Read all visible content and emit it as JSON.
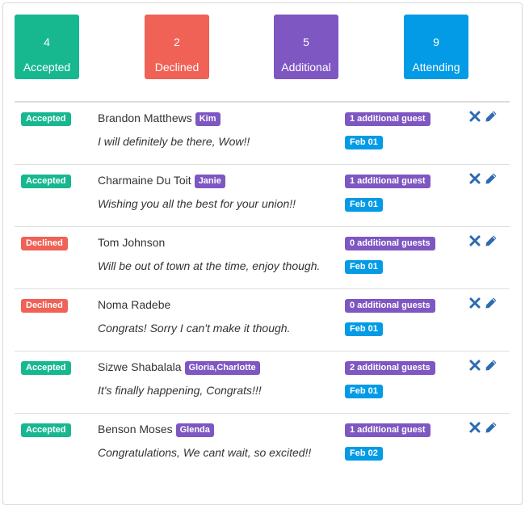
{
  "colors": {
    "accepted": "#17b890",
    "declined": "#f06156",
    "additional": "#7e57c2",
    "attending": "#039be5",
    "icon": "#2d6ab0"
  },
  "stats": [
    {
      "value": "4",
      "label": "Accepted"
    },
    {
      "value": "2",
      "label": "Declined"
    },
    {
      "value": "5",
      "label": "Additional"
    },
    {
      "value": "9",
      "label": "Attending"
    }
  ],
  "rsvps": [
    {
      "status": "Accepted",
      "name": "Brandon Matthews",
      "plus_ones": "Kim",
      "message": "I will definitely be there, Wow!!",
      "guests": "1 additional guest",
      "date": "Feb 01",
      "icons": [
        "close-icon",
        "pencil-icon"
      ]
    },
    {
      "status": "Accepted",
      "name": "Charmaine Du Toit",
      "plus_ones": "Janie",
      "message": "Wishing you all the best for your union!!",
      "guests": "1 additional guest",
      "date": "Feb 01",
      "icons": [
        "close-icon",
        "pencil-icon"
      ]
    },
    {
      "status": "Declined",
      "name": "Tom Johnson",
      "plus_ones": "",
      "message": "Will be out of town at the time, enjoy though.",
      "guests": "0 additional guests",
      "date": "Feb 01",
      "icons": [
        "close-icon",
        "pencil-icon"
      ]
    },
    {
      "status": "Declined",
      "name": "Noma Radebe",
      "plus_ones": "",
      "message": "Congrats! Sorry I can't make it though.",
      "guests": "0 additional guests",
      "date": "Feb 01",
      "icons": [
        "close-icon",
        "pencil-icon"
      ]
    },
    {
      "status": "Accepted",
      "name": "Sizwe Shabalala",
      "plus_ones": "Gloria,Charlotte",
      "message": "It's finally happening, Congrats!!!",
      "guests": "2 additional guests",
      "date": "Feb 01",
      "icons": [
        "close-icon",
        "pencil-icon"
      ]
    },
    {
      "status": "Accepted",
      "name": "Benson Moses",
      "plus_ones": "Glenda",
      "message": "Congratulations, We cant wait, so excited!!",
      "guests": "1 additional guest",
      "date": "Feb 02",
      "icons": [
        "close-icon",
        "pencil-icon"
      ]
    }
  ]
}
